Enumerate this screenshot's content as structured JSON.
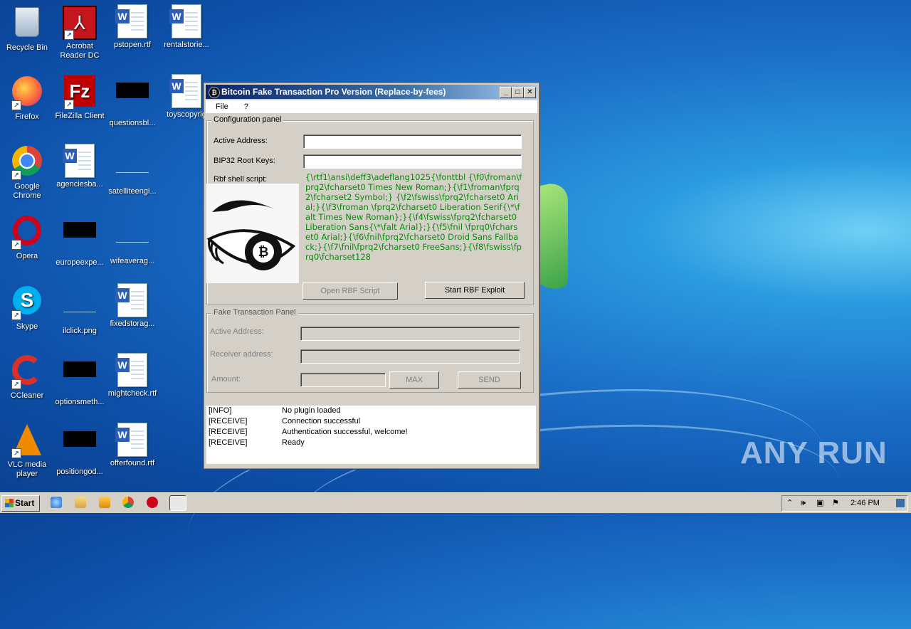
{
  "desktop_icons": [
    {
      "label": "Recycle Bin",
      "icon": "recycle-bin-icon"
    },
    {
      "label": "Acrobat Reader DC",
      "icon": "acrobat-icon"
    },
    {
      "label": "pstopen.rtf",
      "icon": "word-doc-icon"
    },
    {
      "label": "rentalstorie...",
      "icon": "word-doc-icon"
    },
    {
      "label": "Firefox",
      "icon": "firefox-icon"
    },
    {
      "label": "FileZilla Client",
      "icon": "filezilla-icon"
    },
    {
      "label": "questionsbl...",
      "icon": "black-file-icon"
    },
    {
      "label": "toyscopyrig",
      "icon": "word-doc-icon"
    },
    {
      "label": "Google Chrome",
      "icon": "chrome-icon"
    },
    {
      "label": "agenciesba...",
      "icon": "word-doc-icon"
    },
    {
      "label": "satelliteengi...",
      "icon": "blank-file-icon"
    },
    {
      "label": "Opera",
      "icon": "opera-icon"
    },
    {
      "label": "europeexpe...",
      "icon": "black-file-icon"
    },
    {
      "label": "wifeaverag...",
      "icon": "blank-file-icon"
    },
    {
      "label": "Skype",
      "icon": "skype-icon"
    },
    {
      "label": "ilclick.png",
      "icon": "blank-file-icon"
    },
    {
      "label": "fixedstorag...",
      "icon": "word-doc-icon"
    },
    {
      "label": "CCleaner",
      "icon": "ccleaner-icon"
    },
    {
      "label": "optionsmeth...",
      "icon": "black-file-icon"
    },
    {
      "label": "mightcheck.rtf",
      "icon": "word-doc-icon"
    },
    {
      "label": "VLC media player",
      "icon": "vlc-icon"
    },
    {
      "label": "positiongod...",
      "icon": "black-file-icon"
    },
    {
      "label": "offerfound.rtf",
      "icon": "word-doc-icon"
    }
  ],
  "window": {
    "title": "Bitcoin Fake Transaction Pro Version  (Replace-by-fees)",
    "menu": [
      "File",
      "?"
    ],
    "config_panel": {
      "legend": "Configuration panel",
      "active_address_label": "Active Address:",
      "active_address_value": "",
      "bip32_label": "BIP32 Root Keys:",
      "bip32_value": "",
      "rbf_label": "Rbf shell script:",
      "script_text": "{\\rtf1\\ansi\\deff3\\adeflang1025{\\fonttbl {\\f0\\froman\\fprq2\\fcharset0 Times New Roman;}{\\f1\\froman\\fprq2\\fcharset2 Symbol;} {\\f2\\fswiss\\fprq2\\fcharset0 Arial;}{\\f3\\froman \\fprq2\\fcharset0 Liberation Serif{\\*\\falt Times New Roman};}{\\f4\\fswiss\\fprq2\\fcharset0 Liberation Sans{\\*\\falt Arial};}{\\f5\\fnil \\fprq0\\fcharset0 Arial;}{\\f6\\fnil\\fprq2\\fcharset0 Droid Sans Fallback;}{\\f7\\fnil\\fprq2\\fcharset0 FreeSans;}{\\f8\\fswiss\\fprq0\\fcharset128",
      "open_button": "Open RBF Script",
      "start_button": "Start RBF Exploit"
    },
    "fake_panel": {
      "legend": "Fake Transaction Panel",
      "active_address_label": "Active Address:",
      "receiver_label": "Receiver address:",
      "amount_label": "Amount:",
      "max_button": "MAX",
      "send_button": "SEND"
    },
    "log": [
      {
        "tag": "[INFO]",
        "message": "No plugin loaded"
      },
      {
        "tag": "[RECEIVE]",
        "message": "Connection successful"
      },
      {
        "tag": "[RECEIVE]",
        "message": "Authentication successful, welcome!"
      },
      {
        "tag": "[RECEIVE]",
        "message": "Ready"
      }
    ]
  },
  "watermark": "ANY RUN",
  "taskbar": {
    "start_label": "Start",
    "clock": "2:46 PM"
  }
}
